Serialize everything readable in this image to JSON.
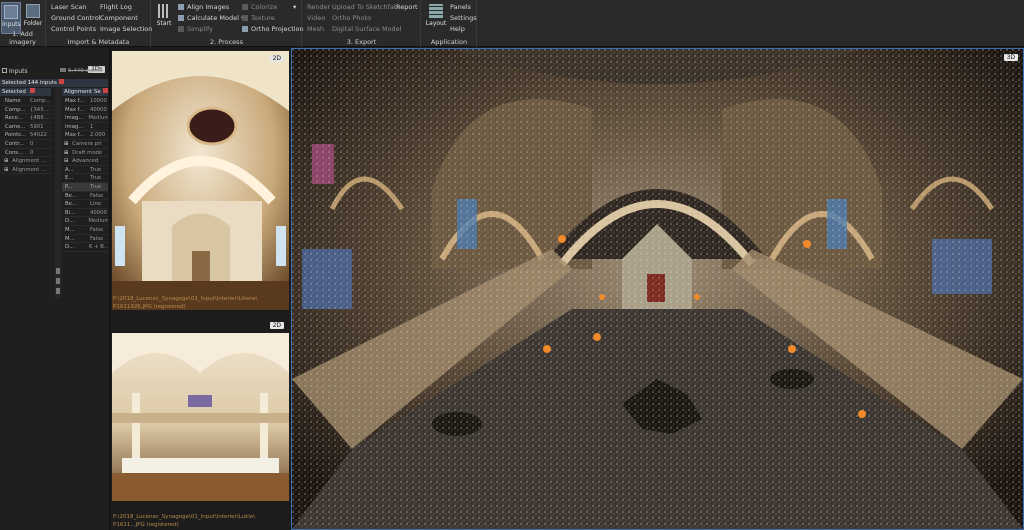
{
  "ribbon": {
    "add_imagery": {
      "title": "1. Add imagery",
      "inputs_label": "Inputs",
      "folder_label": "Folder"
    },
    "import_metadata": {
      "title": "Import & Metadata",
      "col1": [
        "Laser Scan",
        "Ground Control",
        "Control Points"
      ],
      "col2": [
        "Flight Log",
        "Component",
        "Image Selection"
      ]
    },
    "process": {
      "title": "2. Process",
      "start_label": "Start",
      "col1": [
        "Align Images",
        "Calculate Model ▾",
        "Simplify"
      ],
      "col2": [
        "Colorize",
        "Texture",
        "Ortho Projection"
      ]
    },
    "export": {
      "title": "3. Export",
      "col1": [
        "Render",
        "Video",
        "Mesh"
      ],
      "col2": [
        "Upload To Sketchfab",
        "Ortho Photo",
        "Digital Surface Model"
      ],
      "report_label": "Report"
    },
    "application": {
      "title": "Application",
      "layout_label": "Layout",
      "col1": [
        "Panels",
        "Settings",
        "Help"
      ]
    }
  },
  "left_panel": {
    "tab_1ds": "1Ds",
    "inputs_tab": "Inputs",
    "inputs_count": "6,449 inputs",
    "selected_header": "Selected 144 inputs",
    "alignment_header": "Alignment Se",
    "props_left": [
      {
        "k": "Name",
        "v": "Comp..."
      },
      {
        "k": "Comp...",
        "v": "{3A5..."
      },
      {
        "k": "Reco...",
        "v": "{4B6..."
      },
      {
        "k": "Came...",
        "v": "5901"
      },
      {
        "k": "Points...",
        "v": "54022"
      },
      {
        "k": "Contr...",
        "v": "0"
      },
      {
        "k": "Cons...",
        "v": "0"
      }
    ],
    "collapsed_left": [
      "Alignment ...",
      "Alignment ..."
    ],
    "props_right_top": [
      {
        "k": "Max f...",
        "v": "10000"
      },
      {
        "k": "Max f...",
        "v": "40000"
      },
      {
        "k": "Imag...",
        "v": "Medium"
      },
      {
        "k": "Imag...",
        "v": "1"
      },
      {
        "k": "Max f...",
        "v": "2.000"
      }
    ],
    "sections_right": [
      "Camera pri",
      "Draft mode",
      "Advanced"
    ],
    "props_right_adv": [
      {
        "k": "A...",
        "v": "True"
      },
      {
        "k": "E...",
        "v": "True"
      },
      {
        "k": "P...",
        "v": "True"
      },
      {
        "k": "Be...",
        "v": "False"
      },
      {
        "k": "Be...",
        "v": "Line"
      },
      {
        "k": "Bi...",
        "v": "40000"
      },
      {
        "k": "D...",
        "v": "Medium"
      },
      {
        "k": "M...",
        "v": "False"
      },
      {
        "k": "M...",
        "v": "False"
      },
      {
        "k": "D...",
        "v": "K + B..."
      }
    ]
  },
  "twod": {
    "tag": "2D",
    "caption1_line1": "F:\\2018_Lucenec_Synagoge\\01_Input\\Interier\\Lihere\\",
    "caption1_line2": "P1611926.JPG (registered)",
    "caption2_line1": "F:\\2018_Lucenec_Synagoge\\01_Input\\Interier\\Lukle\\",
    "caption2_line2": "P1611...JPG (registered)"
  },
  "view3d": {
    "tag": "3D"
  },
  "colors": {
    "accent_blue": "#3a6fb5",
    "caption_orange": "#b68a4a",
    "ribbon_bg": "#2a2a2a"
  }
}
